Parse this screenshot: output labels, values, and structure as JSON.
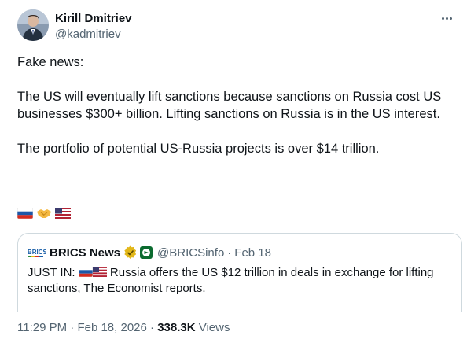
{
  "author": {
    "display_name": "Kirill Dmitriev",
    "handle": "@kadmitriev"
  },
  "tweet": {
    "paragraph_1": "Fake news:",
    "paragraph_2": "The US will eventually lift sanctions because sanctions on Russia cost US businesses $300+ billion. Lifting sanctions on Russia is in the US interest.",
    "paragraph_3": "The portfolio of potential US-Russia projects is over $14 trillion.",
    "emojis": [
      "russia-flag",
      "handshake",
      "us-flag"
    ]
  },
  "quote": {
    "logo_text": "BRICS",
    "display_name": "BRICS News",
    "handle": "@BRICSinfo",
    "separator": "·",
    "date": "Feb 18",
    "text_prefix": "JUST IN: ",
    "text_body": " Russia offers the US $12 trillion in deals in exchange for lifting sanctions, The Economist reports."
  },
  "meta": {
    "time": "11:29 PM",
    "separator_1": " · ",
    "date": "Feb 18, 2026",
    "separator_2": " · ",
    "views_count": "338.3K",
    "views_label": " Views"
  },
  "colors": {
    "text": "#0f1419",
    "secondary": "#536471",
    "border": "#cfd9de",
    "verified_gold": "#e2b719"
  }
}
